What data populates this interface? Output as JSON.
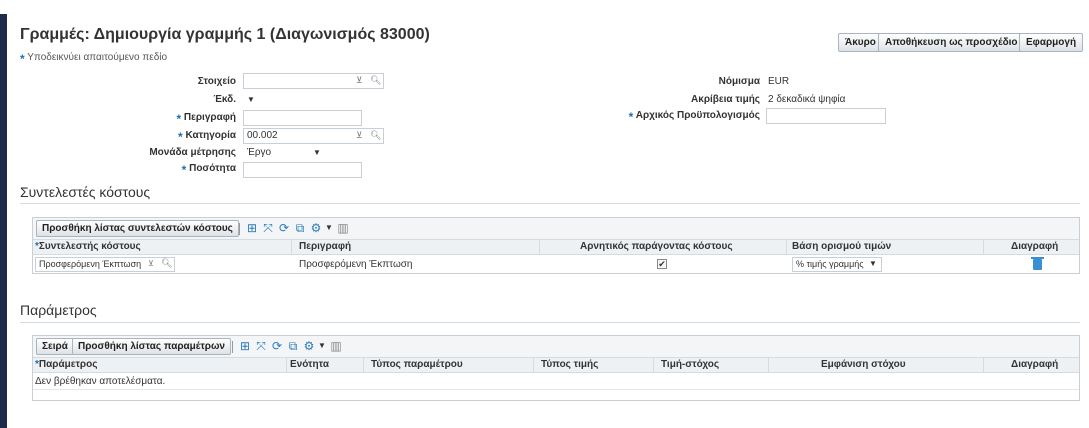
{
  "page": {
    "title": "Γραμμές: Δημιουργία γραμμής 1 (Διαγωνισμός 83000)",
    "required_note": "Υποδεικνύει απαιτούμενο πεδίο"
  },
  "actions": {
    "cancel": "Άκυρο",
    "save_draft": "Αποθήκευση ως προσχέδιο",
    "apply": "Εφαρμογή"
  },
  "form": {
    "item_label": "Στοιχείο",
    "item_value": "",
    "revision_label": "Έκδ.",
    "revision_value": "",
    "description_label": "Περιγραφή",
    "description_value": "",
    "category_label": "Κατηγορία",
    "category_value": "00.002",
    "uom_label": "Μονάδα μέτρησης",
    "uom_value": "Έργο",
    "quantity_label": "Ποσότητα",
    "quantity_value": "",
    "currency_label": "Νόμισμα",
    "currency_value": "EUR",
    "price_precision_label": "Ακρίβεια τιμής",
    "price_precision_value": "2 δεκαδικά ψηφία",
    "initial_budget_label": "Αρχικός Προϋπολογισμός",
    "initial_budget_value": ""
  },
  "cost_factors": {
    "section_title": "Συντελεστές κόστους",
    "add_list_button": "Προσθήκη λίστας συντελεστών κόστους",
    "columns": [
      "Συντελεστής κόστους",
      "Περιγραφή",
      "Αρνητικός παράγοντας κόστους",
      "Βάση ορισμού τιμών",
      "Διαγραφή"
    ],
    "rows": [
      {
        "cost_factor": "Προσφερόμενη Έκπτωση",
        "description": "Προσφερόμενη Έκπτωση",
        "negative_checked": true,
        "pricing_basis": "% τιμής γραμμής"
      }
    ]
  },
  "parameters": {
    "section_title": "Παράμετρος",
    "sequence_button": "Σειρά",
    "add_list_button": "Προσθήκη λίστας παραμέτρων",
    "columns": [
      "Παράμετρος",
      "Ενότητα",
      "Τύπος παραμέτρου",
      "Τύπος τιμής",
      "Τιμή-στόχος",
      "Εμφάνιση στόχου",
      "Διαγραφή"
    ],
    "empty_text": "Δεν βρέθηκαν αποτελέσματα."
  },
  "icons": {
    "add_row": "add-row-icon",
    "detach": "detach-icon",
    "refresh": "refresh-icon",
    "export": "export-icon",
    "settings": "gear-icon",
    "freeze": "freeze-columns-icon",
    "delete": "trash-icon",
    "search": "search-icon"
  },
  "colors": {
    "required_star": "#1f6fb5",
    "frame": "#1f2b4a",
    "icon_blue": "#2a7ab8"
  }
}
